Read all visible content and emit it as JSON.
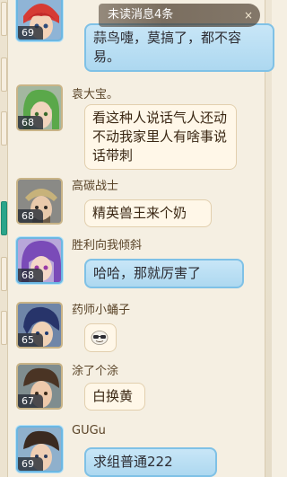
{
  "banner": {
    "text": "未读消息4条",
    "close_symbol": "×"
  },
  "messages": [
    {
      "name": "",
      "level": "69",
      "text": "蒜鸟嚏，莫搞了，都不容易。",
      "theme": "blue"
    },
    {
      "name": "袁大宝。",
      "level": "68",
      "text": "看这种人说话气人还动不动我家里人有啥事说话带刺",
      "theme": "plain"
    },
    {
      "name": "高碳战士",
      "level": "68",
      "text": "精英兽王来个奶",
      "theme": "plain"
    },
    {
      "name": "胜利向我倾斜",
      "level": "68",
      "text": "哈哈，那就厉害了",
      "theme": "blue"
    },
    {
      "name": "药师小蛹子",
      "level": "65",
      "text": "",
      "theme": "plain",
      "sticker": "cool-emoji"
    },
    {
      "name": "涂了个涂",
      "level": "67",
      "text": "白换黄",
      "theme": "plain"
    },
    {
      "name": "GUGu",
      "level": "69",
      "text": "求组普通222",
      "theme": "blue"
    }
  ],
  "colors": {
    "background": "#f5efe2",
    "bubble_plain": "#fff7e8",
    "bubble_blue": "#b7dcf2",
    "active_tab": "#2aa58a"
  }
}
